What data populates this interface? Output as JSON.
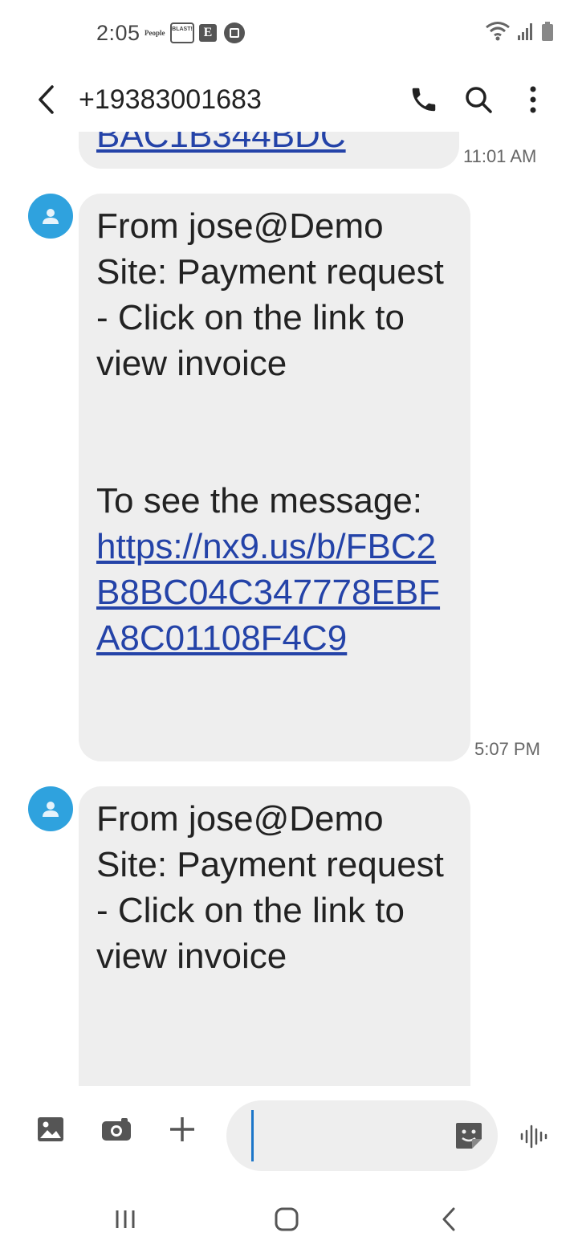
{
  "status_bar": {
    "time": "2:05",
    "notifications": [
      "People",
      "BLAST!",
      "E",
      "square-in-circle"
    ]
  },
  "header": {
    "title": "+19383001683",
    "back_icon": "chevron-left-icon",
    "call_icon": "phone-icon",
    "search_icon": "search-icon",
    "more_icon": "more-vertical-icon"
  },
  "messages": [
    {
      "partial_link": "BAC1B344BDC",
      "time": "11:01 AM"
    },
    {
      "line1": "From jose@Demo Site: Payment request - Click on the link to view invoice",
      "line2_prefix": "To see the message: ",
      "link": "https://nx9.us/b/FBC2B8BC04C347778EBFA8C01108F4C9",
      "time": "5:07 PM"
    },
    {
      "line1": "From jose@Demo Site: Payment request - Click on the link to view invoice"
    }
  ],
  "composer": {
    "input_value": "",
    "icons": [
      "gallery-icon",
      "camera-icon",
      "plus-icon",
      "sticker-icon",
      "voice-icon"
    ]
  },
  "nav": {
    "icons": [
      "recents-icon",
      "home-icon",
      "back-icon"
    ]
  },
  "colors": {
    "bubble": "#eeeeee",
    "link": "#2443a8",
    "avatar": "#2fa2de",
    "caret": "#1c76c9"
  }
}
